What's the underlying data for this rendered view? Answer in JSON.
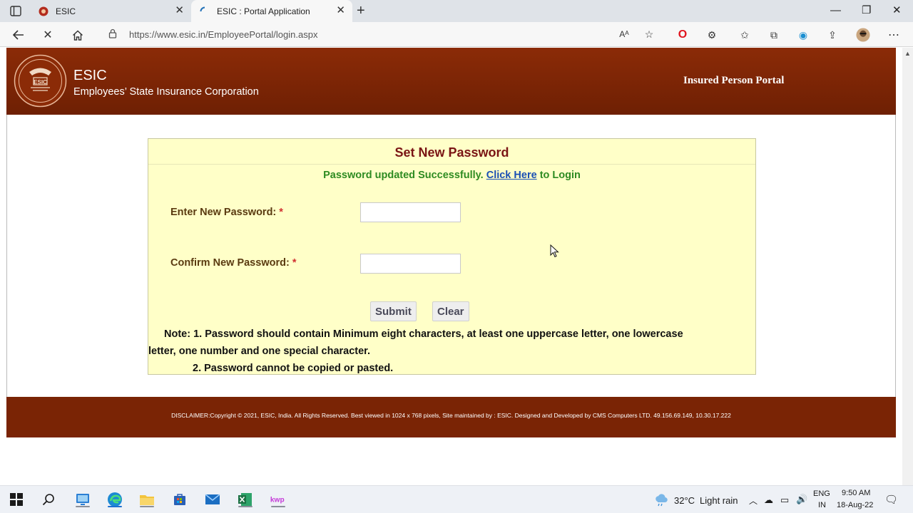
{
  "browser": {
    "tabs": [
      {
        "title": "ESIC",
        "active": false
      },
      {
        "title": "ESIC : Portal Application",
        "active": true
      }
    ],
    "address_bar": {
      "url": "https://www.esic.in/EmployeePortal/login.aspx"
    }
  },
  "header": {
    "brand_name": "ESIC",
    "brand_subtitle": "Employees’ State Insurance Corporation",
    "portal_title": "Insured Person Portal",
    "logo_text": "ESIC"
  },
  "form": {
    "title": "Set New Password",
    "status_message": "Password updated Successfully.",
    "login_link": "Click Here",
    "login_suffix": "to Login",
    "fields": [
      {
        "label": "Enter New Password:",
        "required_mark": "*",
        "value": ""
      },
      {
        "label": "Confirm New Password:",
        "required_mark": "*",
        "value": ""
      }
    ],
    "submit_label": "Submit",
    "clear_label": "Clear",
    "note_line1": "Note: 1. Password should contain Minimum eight characters, at least one uppercase letter, one lowercase",
    "note_line2": "letter, one number and one special character.",
    "note_line3": "2. Password cannot be copied or pasted."
  },
  "footer": {
    "disclaimer": "DISCLAIMER:Copyright © 2021, ESIC, India. All Rights Reserved. Best viewed in 1024 x 768 pixels, Site maintained by : ESIC. Designed and Developed by CMS Computers LTD. 49.156.69.149, 10.30.17.222"
  },
  "taskbar": {
    "weather_temp": "32°C",
    "weather_desc": "Light rain",
    "lang_line1": "ENG",
    "lang_line2": "IN",
    "time": "9:50 AM",
    "date": "18-Aug-22"
  },
  "colors": {
    "header_brown": "#7a2405",
    "panel_yellow": "#ffffc8",
    "success_green": "#2e8b22",
    "link_blue": "#1a4fb4",
    "title_maroon": "#7a1414"
  }
}
